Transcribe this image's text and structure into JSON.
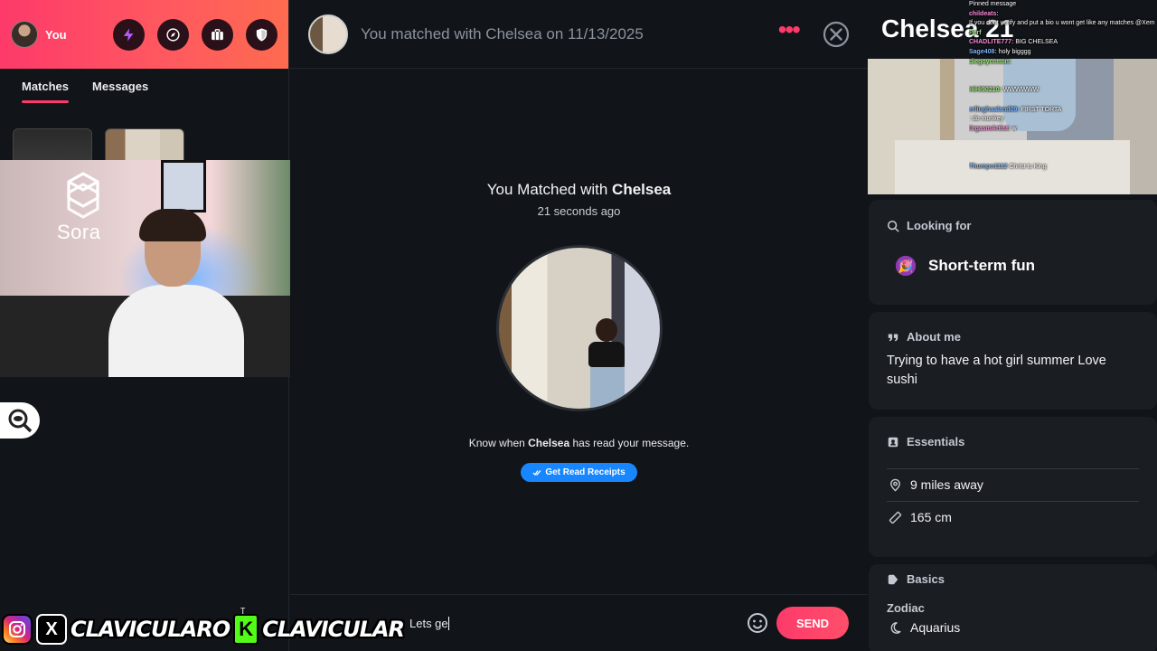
{
  "sidebar": {
    "user_label": "You",
    "tabs": [
      "Matches",
      "Messages"
    ],
    "icons": [
      "bolt-icon",
      "compass-icon",
      "briefcase-icon",
      "shield-icon"
    ]
  },
  "webcam": {
    "brand_text": "Sora"
  },
  "conversation": {
    "header_title": "You matched with Chelsea on 11/13/2025",
    "match_heading_prefix": "You Matched with ",
    "match_name": "Chelsea",
    "match_time": "21 seconds ago",
    "read_prefix": "Know when ",
    "read_suffix": " has read your message.",
    "read_button": "Get Read Receipts",
    "composer_text": "Lets ge",
    "send_label": "SEND"
  },
  "overlay": {
    "x_icon_text": "X",
    "handle_1": "CLAVICULARO",
    "kick_icon_text": "K",
    "handle_2": "CLAVICULAR"
  },
  "chat": [
    {
      "user": "",
      "text": "Pinned message"
    },
    {
      "user": "childeats:",
      "text": ""
    },
    {
      "user": "",
      "text": "If you dont verify and put a bio u wont get like any matches @Xem"
    },
    {
      "user": "Perf",
      "text": ""
    },
    {
      "user": "CHADLITE777:",
      "text": "BIG CHELSEA"
    },
    {
      "user": "Sage408:",
      "text": "holy bigggg"
    },
    {
      "user": "diegoycotton:",
      "text": ""
    },
    {
      "user": "",
      "text": ""
    },
    {
      "user": "",
      "text": ""
    },
    {
      "user": "HiHi90210:",
      "text": "WWWWWW"
    },
    {
      "user": "",
      "text": ""
    },
    {
      "user": "erlinghaaland09:",
      "text": "FIRST TORTA"
    },
    {
      "user": "",
      "text": ": do monkey"
    },
    {
      "user": "0rgasmArtist:",
      "text": "w"
    },
    {
      "user": "",
      "text": ""
    },
    {
      "user": "",
      "text": ""
    },
    {
      "user": "",
      "text": ""
    },
    {
      "user": "Thumpo1112",
      "text": "Christ is King"
    }
  ],
  "profile": {
    "name": "Chelsea",
    "age": "21",
    "looking_for": {
      "title": "Looking for",
      "value": "Short-term fun"
    },
    "about": {
      "title": "About me",
      "text": "Trying to have a hot girl summer Love sushi"
    },
    "essentials": {
      "title": "Essentials",
      "distance": "9 miles away",
      "height": "165 cm"
    },
    "basics": {
      "title": "Basics",
      "zodiac_label": "Zodiac",
      "zodiac_value": "Aquarius"
    }
  },
  "colors": {
    "brand_gradient_start": "#fd3a6a",
    "brand_gradient_end": "#fe6b4f",
    "read_receipt_blue": "#1786ff",
    "kick_green": "#53fc18"
  }
}
